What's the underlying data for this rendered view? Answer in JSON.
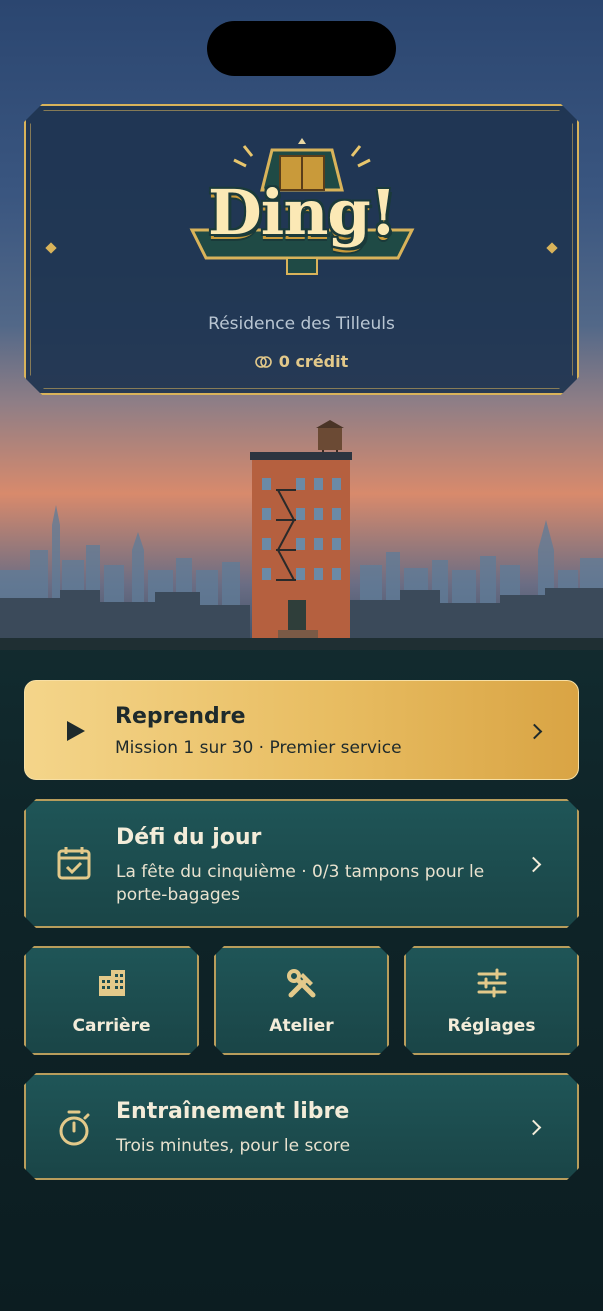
{
  "header": {
    "logo_text": "Ding!",
    "residence": "Résidence des Tilleuls",
    "credit": "0 crédit"
  },
  "actions": {
    "resume": {
      "title": "Reprendre",
      "subtitle": "Mission 1 sur 30 · Premier service"
    },
    "daily": {
      "title": "Défi du jour",
      "subtitle": "La fête du cinquième · 0/3 tampons pour le porte-bagages"
    },
    "tiles": [
      {
        "label": "Carrière",
        "icon": "building-icon"
      },
      {
        "label": "Atelier",
        "icon": "tools-icon"
      },
      {
        "label": "Réglages",
        "icon": "sliders-icon"
      }
    ],
    "training": {
      "title": "Entraînement libre",
      "subtitle": "Trois minutes, pour le score"
    }
  },
  "colors": {
    "gold": "#d9b35a",
    "primary_button": "#e8bd62",
    "card_teal": "#1d4d4f",
    "sky": "#2b4670"
  }
}
